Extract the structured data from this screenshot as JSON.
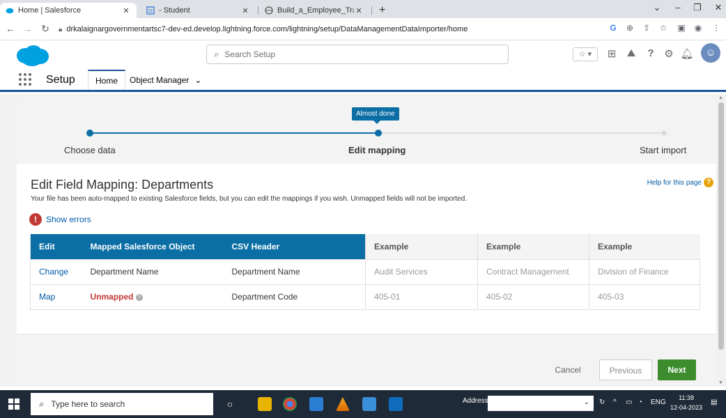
{
  "browser": {
    "tabs": [
      {
        "title": "Home | Salesforce"
      },
      {
        "title": "- Student"
      },
      {
        "title": "Build_a_Employee_Travel_Approv"
      }
    ],
    "new_tab": "+",
    "url": "drkalaignargovernmentartsc7-dev-ed.develop.lightning.force.com/lightning/setup/DataManagementDataImporter/home"
  },
  "sf_header": {
    "search_placeholder": "Search Setup"
  },
  "setup_nav": {
    "app_label": "Setup",
    "tabs": [
      {
        "label": "Home"
      },
      {
        "label": "Object Manager"
      }
    ]
  },
  "progress": {
    "tooltip": "Almost done",
    "steps": [
      {
        "label": "Choose data"
      },
      {
        "label": "Edit mapping"
      },
      {
        "label": "Start import"
      }
    ],
    "current_step": 2
  },
  "page": {
    "title": "Edit Field Mapping: Departments",
    "help_link": "Help for this page",
    "description": "Your file has been auto-mapped to existing Salesforce fields, but you can edit the mappings if you wish. Unmapped fields will not be imported.",
    "show_errors": "Show errors"
  },
  "mapping_table": {
    "headers": [
      "Edit",
      "Mapped Salesforce Object",
      "CSV Header",
      "Example",
      "Example",
      "Example"
    ],
    "rows": [
      {
        "action": "Change",
        "mapped": "Department Name",
        "csv": "Department Name",
        "examples": [
          "Audit Services",
          "Contract Management",
          "Division of Finance"
        ]
      },
      {
        "action": "Map",
        "mapped": "Unmapped",
        "csv": "Department Code",
        "examples": [
          "405-01",
          "405-02",
          "405-03"
        ]
      }
    ]
  },
  "footer": {
    "cancel": "Cancel",
    "previous": "Previous",
    "next": "Next"
  },
  "taskbar": {
    "search_placeholder": "Type here to search",
    "address_label": "Address",
    "lang": "ENG",
    "time": "11:38",
    "date": "12-04-2023"
  },
  "colors": {
    "salesforce_blue": "#00a1e0",
    "progress_blue": "#0b6fa5",
    "next_green": "#3d8d2f",
    "error_red": "#c23934",
    "link_blue": "#015ba7"
  }
}
